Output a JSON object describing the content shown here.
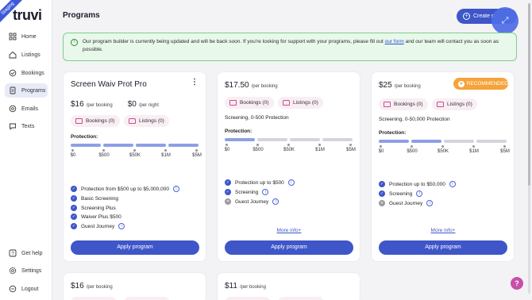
{
  "env_badge": "Staging",
  "logo": "truvi",
  "sidebar": {
    "items": [
      {
        "label": "Home",
        "icon": "grid-icon"
      },
      {
        "label": "Listings",
        "icon": "house-icon"
      },
      {
        "label": "Bookings",
        "icon": "bookings-icon"
      },
      {
        "label": "Programs",
        "icon": "document-icon"
      },
      {
        "label": "Emails",
        "icon": "mail-icon"
      },
      {
        "label": "Texts",
        "icon": "chat-icon"
      }
    ],
    "bottom_items": [
      {
        "label": "Get help",
        "icon": "question-icon"
      },
      {
        "label": "Settings",
        "icon": "gear-icon"
      },
      {
        "label": "Logout",
        "icon": "logout-icon"
      }
    ],
    "active": "Programs"
  },
  "header": {
    "title": "Programs",
    "create_label": "Create p"
  },
  "notice": {
    "text_before": "Our program builder is currently being updated and will be back soon. If you're looking for support with your programs, please fill out ",
    "link": "our form",
    "text_after": " and our team will contact you as soon as possible."
  },
  "scale_labels": [
    "$0",
    "$500",
    "$50K",
    "$1M",
    "$5M"
  ],
  "colors": {
    "accent": "#3e56c8",
    "bar_filled": "#8d9fe6",
    "bar_empty": "#d3d5dc",
    "notice_bg": "#e8f8ea",
    "recommended": "#f5a33a"
  },
  "cards": [
    {
      "title": "Screen Waiv Prot Pro",
      "price": "$16",
      "price_unit": "/per booking",
      "price2": "$0",
      "price2_unit": "/per night",
      "bookings_pill": "Bookings (0)",
      "listings_pill": "Listings (0)",
      "protection_label": "Protection:",
      "protection_levels": 4,
      "features": [
        {
          "text": "Protection from $500 up to $5,000,000",
          "on": true,
          "info": true
        },
        {
          "text": "Basic Screening",
          "on": true,
          "info": false
        },
        {
          "text": "Screening Plus",
          "on": true,
          "info": false
        },
        {
          "text": "Waiver Plus $500",
          "on": true,
          "info": false
        },
        {
          "text": "Guest Journey",
          "on": true,
          "info": true
        }
      ],
      "apply_label": "Apply program"
    },
    {
      "price": "$17.50",
      "price_unit": "/per booking",
      "bookings_pill": "Bookings (0)",
      "listings_pill": "Listings (0)",
      "screening": "Screening, 0-500 Protection",
      "protection_label": "Protection:",
      "protection_levels": 1,
      "features": [
        {
          "text": "Protection up to $500",
          "on": true,
          "info": true
        },
        {
          "text": "Screening",
          "on": true,
          "info": true
        },
        {
          "text": "Guest Journey",
          "on": false,
          "info": true
        }
      ],
      "more_info": "More info+",
      "apply_label": "Apply program"
    },
    {
      "price": "$25",
      "price_unit": "/per booking",
      "recommended": "RECOMMENDED",
      "bookings_pill": "Bookings (0)",
      "listings_pill": "Listings (0)",
      "screening": "Screening, 0-50,000 Protection",
      "protection_label": "Protection:",
      "protection_levels": 2,
      "features": [
        {
          "text": "Protection up to $50,000",
          "on": true,
          "info": true
        },
        {
          "text": "Screening",
          "on": true,
          "info": true
        },
        {
          "text": "Guest Journey",
          "on": false,
          "info": true
        }
      ],
      "more_info": "More info+",
      "apply_label": "Apply program"
    },
    {
      "price": "$16",
      "price_unit": "/per booking"
    },
    {
      "price": "$11",
      "price_unit": "/per booking"
    }
  ],
  "help_fab": "?"
}
